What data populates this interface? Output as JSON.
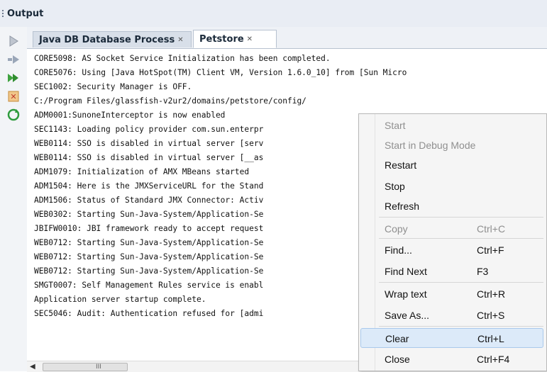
{
  "window": {
    "title": "Output"
  },
  "tabs": [
    {
      "label": "Java DB Database Process",
      "active": false
    },
    {
      "label": "Petstore",
      "active": true
    }
  ],
  "console_lines": [
    "CORE5098: AS Socket Service Initialization has been completed.",
    "CORE5076: Using [Java HotSpot(TM) Client VM, Version 1.6.0_10] from [Sun Micro",
    "SEC1002: Security Manager is OFF.",
    "C:/Program Files/glassfish-v2ur2/domains/petstore/config/",
    "ADM0001:SunoneInterceptor is now enabled",
    "SEC1143: Loading policy provider com.sun.enterpr",
    "WEB0114: SSO is disabled in virtual server [serv",
    "WEB0114: SSO is disabled in virtual server [__as",
    "ADM1079: Initialization of AMX MBeans started",
    "ADM1504: Here is the JMXServiceURL for the Stand",
    "ADM1506: Status of Standard JMX Connector: Activ",
    "WEB0302: Starting Sun-Java-System/Application-Se",
    "JBIFW0010: JBI framework ready to accept request",
    "WEB0712: Starting Sun-Java-System/Application-Se",
    "WEB0712: Starting Sun-Java-System/Application-Se",
    "WEB0712: Starting Sun-Java-System/Application-Se",
    "SMGT0007: Self Management Rules service is enabl",
    "Application server startup complete.",
    "SEC5046: Audit: Authentication refused for [admi"
  ],
  "context_menu": {
    "items": [
      {
        "label": "Start",
        "shortcut": "",
        "disabled": true
      },
      {
        "label": "Start in Debug Mode",
        "shortcut": "",
        "disabled": true
      },
      {
        "label": "Restart",
        "shortcut": "",
        "disabled": false
      },
      {
        "label": "Stop",
        "shortcut": "",
        "disabled": false
      },
      {
        "label": "Refresh",
        "shortcut": "",
        "disabled": false
      },
      {
        "label": "Copy",
        "shortcut": "Ctrl+C",
        "disabled": true
      },
      {
        "label": "Find...",
        "shortcut": "Ctrl+F",
        "disabled": false
      },
      {
        "label": "Find Next",
        "shortcut": "F3",
        "disabled": false
      },
      {
        "label": "Wrap text",
        "shortcut": "Ctrl+R",
        "disabled": false
      },
      {
        "label": "Save As...",
        "shortcut": "Ctrl+S",
        "disabled": false
      },
      {
        "label": "Clear",
        "shortcut": "Ctrl+L",
        "disabled": false,
        "highlighted": true
      },
      {
        "label": "Close",
        "shortcut": "Ctrl+F4",
        "disabled": false
      }
    ]
  },
  "sidebar_icons": [
    "play-icon",
    "rerun-icon",
    "fast-forward-icon",
    "stop-icon",
    "refresh-icon"
  ],
  "scrollbar": {
    "left_arrow": "◀",
    "grip": "III"
  },
  "colors": {
    "header_bg": "#e9edf4",
    "menu_bg": "#f5f5f5",
    "menu_highlight": "#dceaf9",
    "disabled_text": "#8f8f8f"
  }
}
